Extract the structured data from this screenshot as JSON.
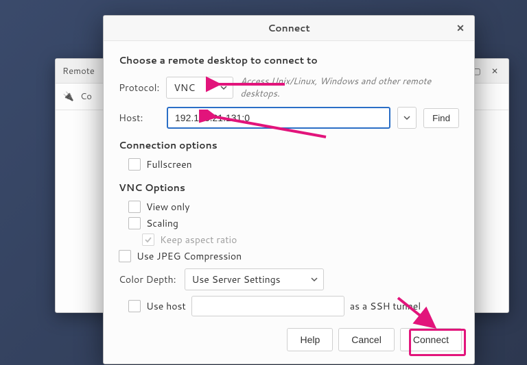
{
  "dialog": {
    "title": "Connect",
    "close_glyph": "✕",
    "heading": "Choose a remote desktop to connect to",
    "protocol_label": "Protocol:",
    "protocol_value": "VNC",
    "protocol_hint": "Access Unix/Linux, Windows and other remote desktops.",
    "host_label": "Host:",
    "host_value": "192.168.21.131:0",
    "find_label": "Find",
    "conn_options_heading": "Connection options",
    "fullscreen_label": "Fullscreen",
    "vnc_options_heading": "VNC Options",
    "view_only_label": "View only",
    "scaling_label": "Scaling",
    "keep_aspect_label": "Keep aspect ratio",
    "use_jpeg_label": "Use JPEG Compression",
    "color_depth_label": "Color Depth:",
    "color_depth_value": "Use Server Settings",
    "ssh_use_host_label": "Use host",
    "ssh_tunnel_suffix": "as a SSH tunnel",
    "buttons": {
      "help": "Help",
      "cancel": "Cancel",
      "connect": "Connect"
    }
  },
  "background_app": {
    "title_fragment": "Remote",
    "toolbar_fragment": "Co"
  },
  "annotations": [
    {
      "kind": "arrow",
      "target": "protocol-dropdown"
    },
    {
      "kind": "arrow",
      "target": "host-input"
    },
    {
      "kind": "arrow+box",
      "target": "connect-button"
    }
  ]
}
